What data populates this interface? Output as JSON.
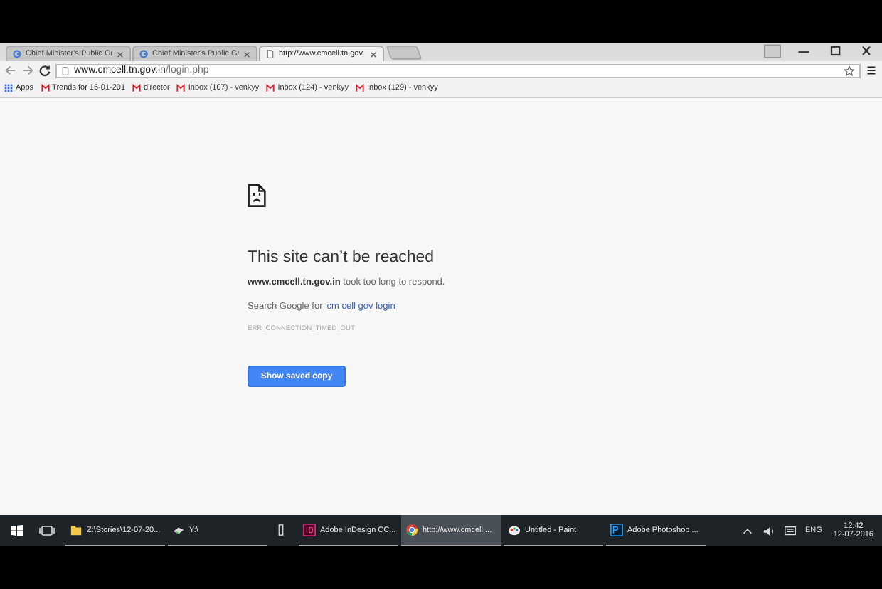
{
  "tabs": [
    {
      "title": "Chief Minister's Public Gr",
      "kind": "google",
      "selected": false
    },
    {
      "title": "Chief Minister's Public Gr",
      "kind": "google",
      "selected": false
    },
    {
      "title": "http://www.cmcell.tn.gov",
      "kind": "page",
      "selected": true
    }
  ],
  "address": {
    "host": "www.cmcell.tn.gov.in",
    "path": "/login.php"
  },
  "bookmarks": [
    {
      "kind": "apps",
      "label": "Apps"
    },
    {
      "kind": "gmail",
      "label": "Trends for 16-01-201"
    },
    {
      "kind": "gmail",
      "label": "director"
    },
    {
      "kind": "gmail",
      "label": "Inbox (107) - venkyy"
    },
    {
      "kind": "gmail",
      "label": "Inbox (124) - venkyy"
    },
    {
      "kind": "gmail",
      "label": "Inbox (129) - venkyy"
    }
  ],
  "error": {
    "title": "This site can’t be reached",
    "description": "**www.cmcell.tn.gov.in** took too long to respond.",
    "search_prefix": "Search Google for",
    "search_link": "cm cell gov login",
    "code": "ERR_CONNECTION_TIMED_OUT",
    "button": "Show saved copy"
  },
  "taskbar": {
    "items": [
      {
        "kind": "folder",
        "label": "Z:\\Stories\\12-07-20...",
        "selected": false
      },
      {
        "kind": "drive",
        "label": "Y:\\",
        "selected": false
      },
      {
        "kind": "device",
        "selected": false
      },
      {
        "kind": "indesign",
        "label": "Adobe InDesign CC...",
        "selected": false
      },
      {
        "kind": "chrome",
        "label": "http://www.cmcell....",
        "selected": true
      },
      {
        "kind": "paint",
        "label": "Untitled - Paint",
        "selected": false
      },
      {
        "kind": "photoshop",
        "label": "Adobe Photoshop ...",
        "selected": false
      }
    ],
    "language": "ENG",
    "time": "12:42",
    "date": "12-07-2016"
  }
}
